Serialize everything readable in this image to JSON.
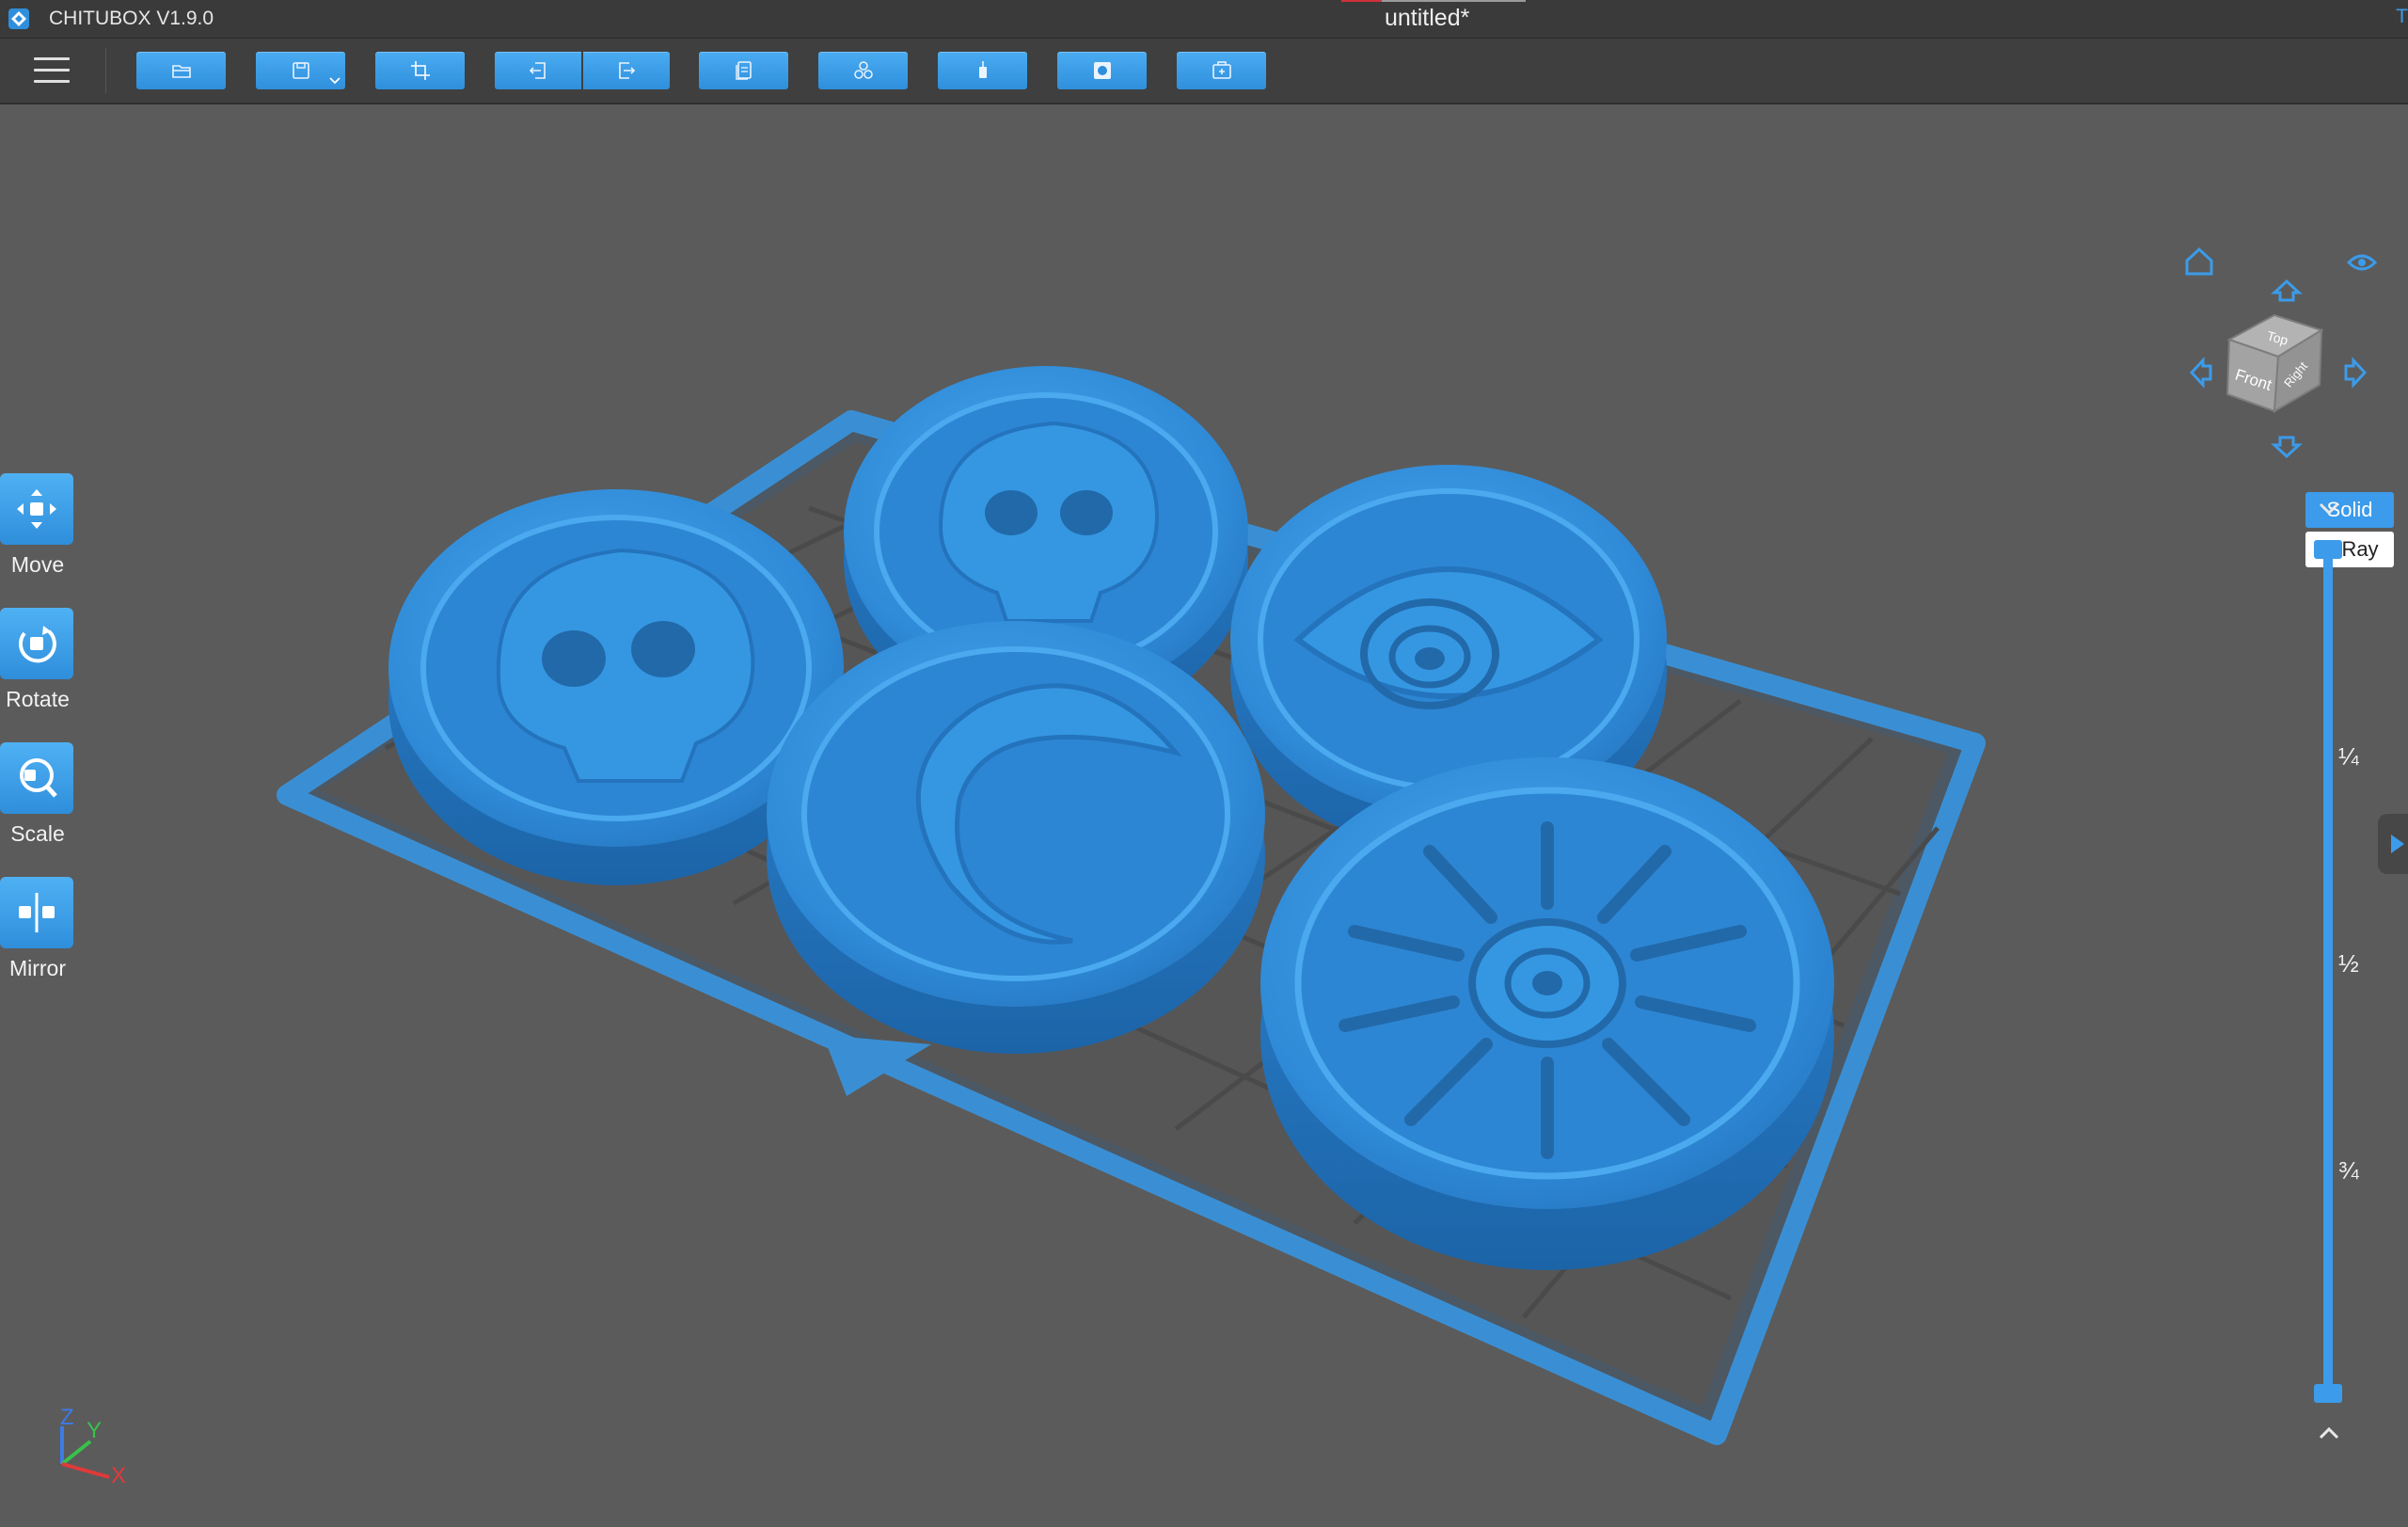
{
  "window": {
    "app_title": "CHITUBOX V1.9.0",
    "doc_title": "untitled*",
    "edge_text": "T"
  },
  "toolbar": {
    "buttons": [
      {
        "name": "open-button",
        "icon": "folder-icon"
      },
      {
        "name": "save-button",
        "icon": "floppy-icon"
      },
      {
        "name": "crop-button",
        "icon": "crop-icon"
      },
      {
        "name": "import-button",
        "icon": "import-icon"
      },
      {
        "name": "export-button",
        "icon": "export-icon"
      },
      {
        "name": "layers-button",
        "icon": "layers-icon"
      },
      {
        "name": "arrange-button",
        "icon": "arrange-icon"
      },
      {
        "name": "supports-button",
        "icon": "supports-icon"
      },
      {
        "name": "hollow-button",
        "icon": "hollow-icon"
      },
      {
        "name": "slice-button",
        "icon": "slice-icon"
      }
    ]
  },
  "tools": [
    {
      "label": "Move",
      "icon": "move-icon"
    },
    {
      "label": "Rotate",
      "icon": "rotate-icon"
    },
    {
      "label": "Scale",
      "icon": "scale-icon"
    },
    {
      "label": "Mirror",
      "icon": "mirror-icon"
    }
  ],
  "viewcube": {
    "faces": {
      "top": "Top",
      "front": "Front",
      "right": "Right"
    }
  },
  "render_mode": {
    "solid_label": "Solid",
    "xray_label": "X-Ray",
    "selected": "Solid"
  },
  "layer_slider": {
    "marks": [
      "¼",
      "½",
      "¾"
    ]
  },
  "axes": {
    "x": "X",
    "y": "Y",
    "z": "Z"
  },
  "colors": {
    "accent": "#3c9bea",
    "model": "#3391dc",
    "background": "#5b5b5b",
    "titlebar": "#3a3a3a",
    "toolbar": "#3f3f3f"
  },
  "scene_objects": [
    {
      "name": "coin-skull-left",
      "emblem": "skull"
    },
    {
      "name": "coin-skull-back",
      "emblem": "skull"
    },
    {
      "name": "coin-eye",
      "emblem": "eye"
    },
    {
      "name": "coin-crescent",
      "emblem": "crescent"
    },
    {
      "name": "coin-sunburst",
      "emblem": "sunburst"
    }
  ]
}
